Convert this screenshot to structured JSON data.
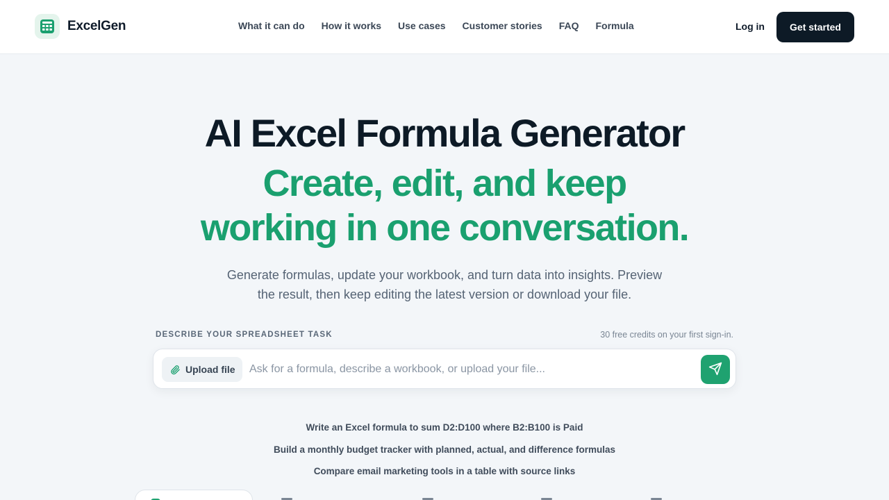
{
  "brand": {
    "name": "ExcelGen",
    "accent": "#1aa06f",
    "dark": "#0d1a26"
  },
  "nav": {
    "items": [
      "What it can do",
      "How it works",
      "Use cases",
      "Customer stories",
      "FAQ",
      "Formula"
    ],
    "login": "Log in",
    "cta": "Get started"
  },
  "hero": {
    "title": "AI Excel Formula Generator",
    "subtitle_line1": "Create, edit, and keep",
    "subtitle_line2": "working in one conversation.",
    "description_line1": "Generate formulas, update your workbook, and turn data into insights. Preview",
    "description_line2": "the result, then keep editing the latest version or download your file."
  },
  "composer": {
    "label": "DESCRIBE YOUR SPREADSHEET TASK",
    "credits": "30 free credits on your first sign-in.",
    "upload_label": "Upload file",
    "placeholder": "Ask for a formula, describe a workbook, or upload your file...",
    "value": ""
  },
  "examples": [
    "Write an Excel formula to sum D2:D100 where B2:B100 is Paid",
    "Build a monthly budget tracker with planned, actual, and difference formulas",
    "Compare email marketing tools in a table with source links"
  ]
}
